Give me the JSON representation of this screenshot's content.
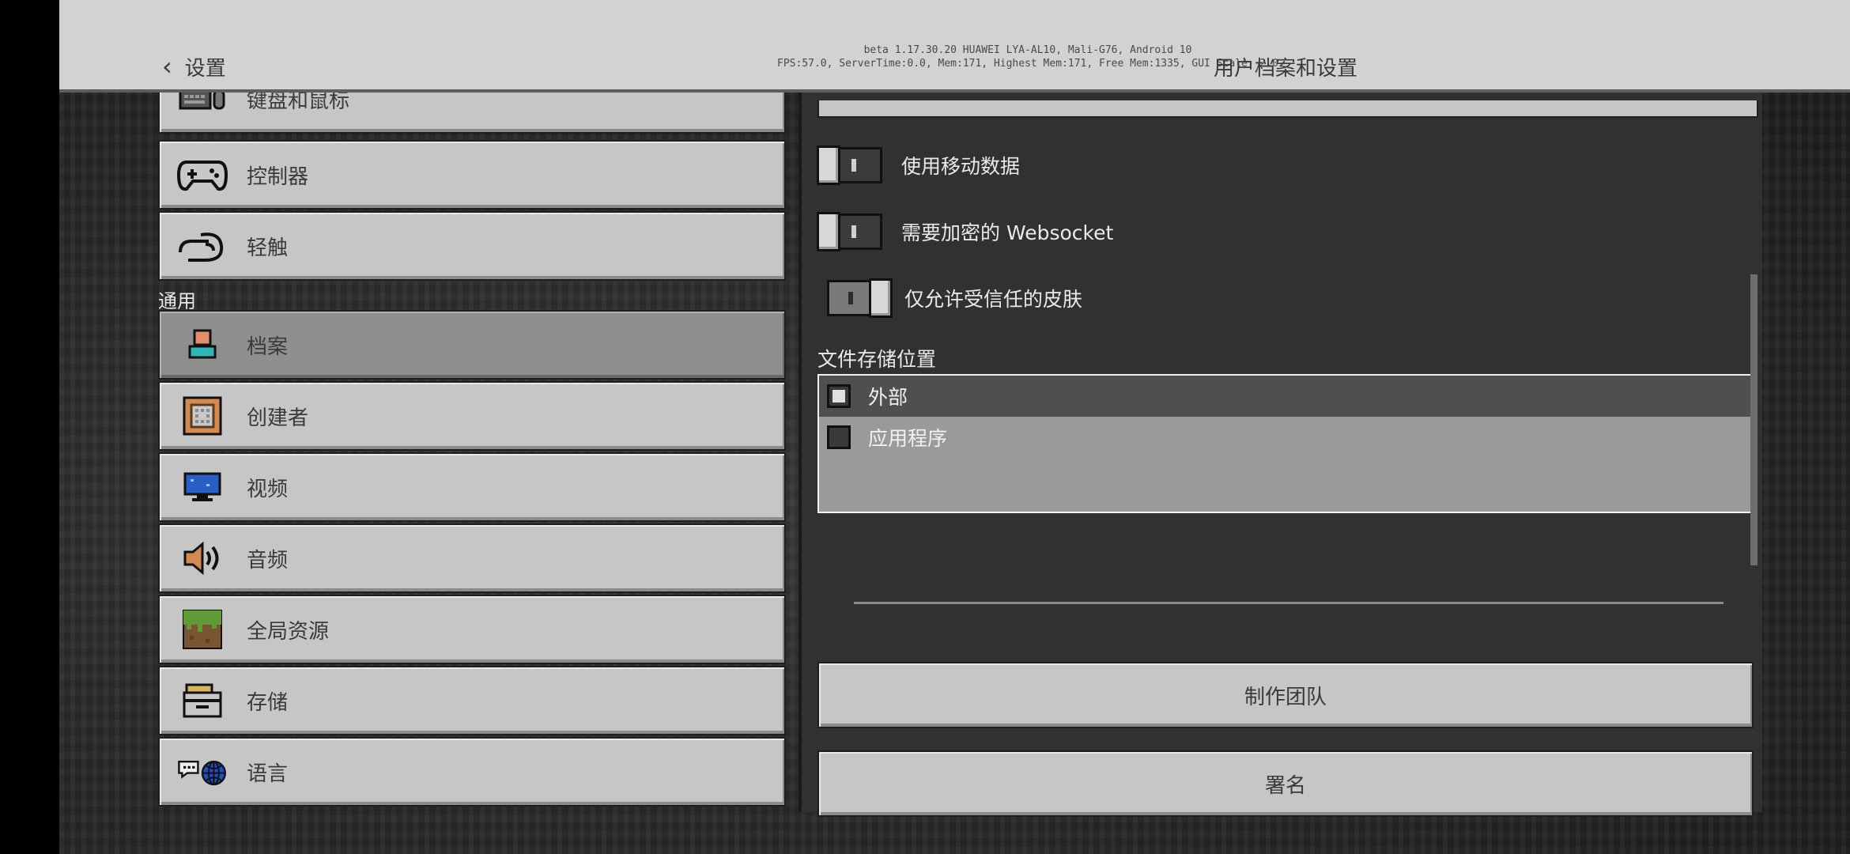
{
  "header": {
    "back_label": "设置",
    "debug_line1": "beta 1.17.30.20 HUAWEI LYA-AL10, Mali-G76, Android 10",
    "debug_line2": "FPS:57.0, ServerTime:0.0, Mem:171, Highest Mem:171, Free Mem:1335, GUI Scale: 2.0",
    "title": "用户档案和设置"
  },
  "sidebar": {
    "section_general": "通用",
    "items": [
      {
        "label": "键盘和鼠标",
        "icon": "keyboard-mouse-icon"
      },
      {
        "label": "控制器",
        "icon": "gamepad-icon"
      },
      {
        "label": "轻触",
        "icon": "touch-icon"
      },
      {
        "label": "档案",
        "icon": "profile-icon"
      },
      {
        "label": "创建者",
        "icon": "command-block-icon"
      },
      {
        "label": "视频",
        "icon": "monitor-icon"
      },
      {
        "label": "音频",
        "icon": "speaker-icon"
      },
      {
        "label": "全局资源",
        "icon": "grass-block-icon"
      },
      {
        "label": "存储",
        "icon": "storage-box-icon"
      },
      {
        "label": "语言",
        "icon": "language-globe-icon"
      }
    ]
  },
  "main": {
    "toggles": [
      {
        "label": "使用移动数据",
        "state": "off"
      },
      {
        "label": "需要加密的 Websocket",
        "state": "off"
      },
      {
        "label": "仅允许受信任的皮肤",
        "state": "on"
      }
    ],
    "storage_title": "文件存储位置",
    "storage_options": [
      {
        "label": "外部",
        "selected": true
      },
      {
        "label": "应用程序",
        "selected": false
      }
    ],
    "credits_button": "制作团队",
    "attribution_button": "署名"
  }
}
